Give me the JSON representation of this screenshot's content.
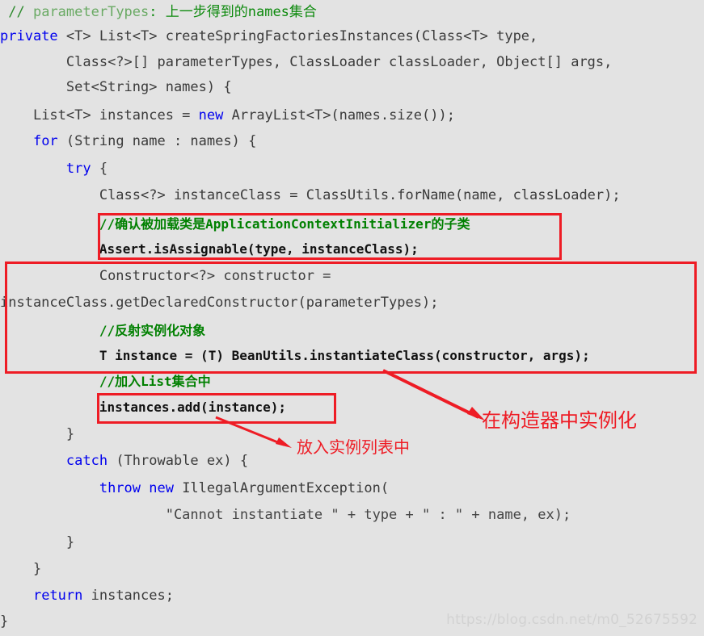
{
  "page": {
    "background_color": "#e3e3e3",
    "code_color": "#444444",
    "keyword_color": "#0000ee",
    "comment_color": "#008000",
    "annotation_color": "#ee1c25",
    "watermark": "https://blog.csdn.net/m0_52675592"
  },
  "code": {
    "lines": [
      {
        "indent": "",
        "text": "// parameterTypes: 上一步得到的names集合"
      },
      {
        "indent": "",
        "text": "private <T> List<T> createSpringFactoriesInstances(Class<T> type,"
      },
      {
        "indent": "        ",
        "text": "Class<?>[] parameterTypes, ClassLoader classLoader, Object[] args,"
      },
      {
        "indent": "        ",
        "text": "Set<String> names) {"
      },
      {
        "indent": "    ",
        "text": "List<T> instances = new ArrayList<T>(names.size());"
      },
      {
        "indent": "    ",
        "text": "for (String name : names) {"
      },
      {
        "indent": "        ",
        "text": "try {"
      },
      {
        "indent": "            ",
        "text": "Class<?> instanceClass = ClassUtils.forName(name, classLoader);"
      },
      {
        "indent": "            ",
        "text": "//确认被加载类是ApplicationContextInitializer的子类"
      },
      {
        "indent": "            ",
        "text": "Assert.isAssignable(type, instanceClass);"
      },
      {
        "indent": "            ",
        "text": "Constructor<?> constructor ="
      },
      {
        "indent": "",
        "text": "instanceClass.getDeclaredConstructor(parameterTypes);"
      },
      {
        "indent": "            ",
        "text": "//反射实例化对象"
      },
      {
        "indent": "            ",
        "text": "T instance = (T) BeanUtils.instantiateClass(constructor, args);"
      },
      {
        "indent": "            ",
        "text": "//加入List集合中"
      },
      {
        "indent": "            ",
        "text": "instances.add(instance);"
      },
      {
        "indent": "        ",
        "text": "}"
      },
      {
        "indent": "        ",
        "text": "catch (Throwable ex) {"
      },
      {
        "indent": "            ",
        "text": "throw new IllegalArgumentException("
      },
      {
        "indent": "                    ",
        "text": "\"Cannot instantiate \" + type + \" : \" + name, ex);"
      },
      {
        "indent": "        ",
        "text": "}"
      },
      {
        "indent": "    ",
        "text": "}"
      },
      {
        "indent": "    ",
        "text": "return instances;"
      },
      {
        "indent": "",
        "text": "}"
      }
    ],
    "line_01_comment_prefix": "// ",
    "line_01_comment_ident": "parameterTypes",
    "line_01_comment_rest": ": 上一步得到的names集合",
    "line_02_kw": "private",
    "line_02_rest": " <T> List<T> createSpringFactoriesInstances(Class<T> type,",
    "line_03": "Class<?>[] parameterTypes, ClassLoader classLoader, Object[] args,",
    "line_04": "Set<String> names) {",
    "line_05_a": "List<T> instances = ",
    "line_05_kw": "new",
    "line_05_b": " ArrayList<T>(names.size());",
    "line_06_kw": "for",
    "line_06_rest": " (String name : names) {",
    "line_07_kw": "try",
    "line_07_rest": " {",
    "line_08": "Class<?> instanceClass = ClassUtils.forName(name, classLoader);",
    "line_09_comment": "//确认被加载类是ApplicationContextInitializer的子类",
    "line_10_bold": "Assert.isAssignable(type, instanceClass);",
    "line_11": "Constructor<?> constructor =",
    "line_12": "instanceClass.getDeclaredConstructor(parameterTypes);",
    "line_13_comment": "//反射实例化对象",
    "line_14_bold": "T instance = (T) BeanUtils.instantiateClass(constructor, args);",
    "line_15_comment": "//加入List集合中",
    "line_16_bold": "instances.add(instance);",
    "line_17": "}",
    "line_18_kw": "catch",
    "line_18_rest": " (Throwable ex) {",
    "line_19_kw": "throw new",
    "line_19_rest": " IllegalArgumentException(",
    "line_20": "\"Cannot instantiate \" + type + \" : \" + name, ex);",
    "line_21": "}",
    "line_22": "}",
    "line_23_kw": "return",
    "line_23_rest": " instances;",
    "line_24": "}"
  },
  "annotations": {
    "box_assert_label": "Assert.isAssignable highlight box",
    "box_constructor_label": "constructor instantiation highlight box",
    "box_add_label": "instances.add highlight box",
    "callout_constructor": "在构造器中实例化",
    "callout_add": "放入实例列表中"
  }
}
